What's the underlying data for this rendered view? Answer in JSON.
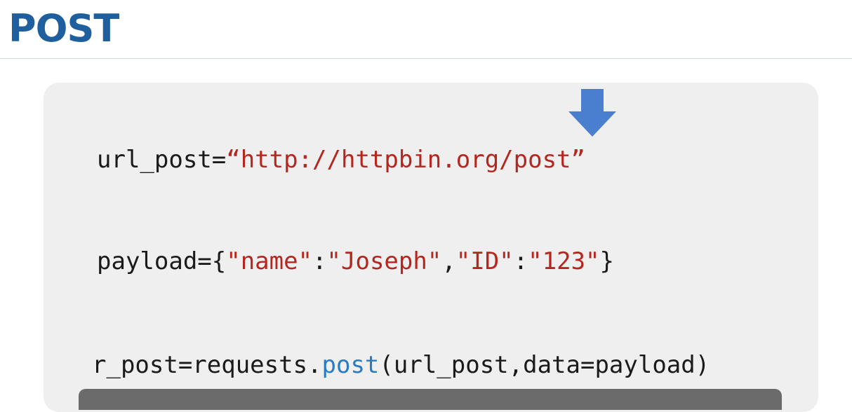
{
  "slide": {
    "title": "POST"
  },
  "code": {
    "line1": {
      "var": "url_post=",
      "value": "“http://httpbin.org/post”"
    },
    "line2": {
      "var": "payload={",
      "k1": "\"name\"",
      "colon1": ":",
      "v1": "\"Joseph\"",
      "comma": ",",
      "k2": "\"ID\"",
      "colon2": ":",
      "v2": "\"123\"",
      "close": "}"
    },
    "line3": {
      "prefix": "r_post=requests.",
      "method": "post",
      "args": "(url_post,data=payload)"
    }
  },
  "icons": {
    "arrow": "down-arrow-icon",
    "arrow_color": "#4a7fcf"
  },
  "colors": {
    "title": "#1f5f9e",
    "string": "#b5261e",
    "method": "#2a7bc4",
    "panel": "#efefef"
  }
}
